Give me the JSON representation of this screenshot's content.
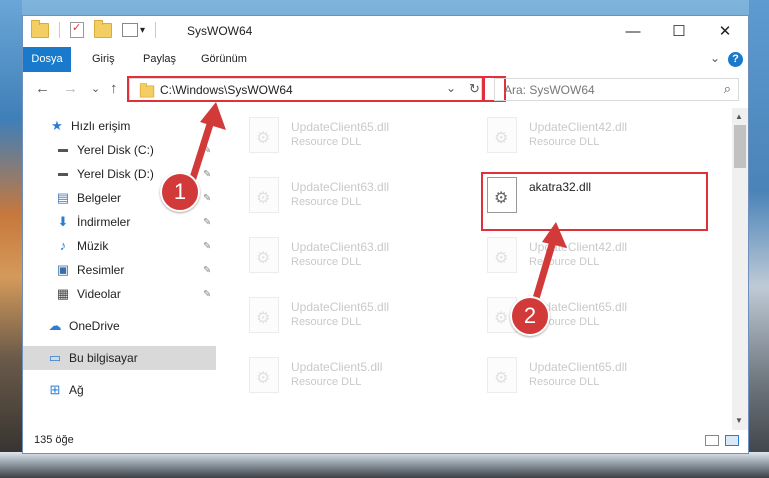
{
  "window": {
    "title": "SysWOW64"
  },
  "titlebar": {
    "minimize_glyph": "—",
    "maximize_glyph": "☐",
    "close_glyph": "✕",
    "qa_dropdown_glyph": "▾"
  },
  "menu": {
    "items": [
      "Dosya",
      "Giriş",
      "Paylaş",
      "Görünüm"
    ],
    "help_glyph": "?",
    "expand_glyph": "⌄"
  },
  "nav": {
    "back_glyph": "←",
    "forward_glyph": "→",
    "recent_glyph": "⌄",
    "up_glyph": "↑",
    "address": "C:\\Windows\\SysWOW64",
    "address_dropdown_glyph": "⌄",
    "refresh_glyph": "↻",
    "search_placeholder": "Ara: SysWOW64",
    "search_glyph": "⌕"
  },
  "sidebar": {
    "items": [
      {
        "label": "Hızlı erişim",
        "icon": "star-icon",
        "glyph": "★",
        "color": "#2b7cd3",
        "pinned": false
      },
      {
        "label": "Yerel Disk (C:)",
        "icon": "drive-icon",
        "glyph": "▬",
        "color": "#555555",
        "pinned": true
      },
      {
        "label": "Yerel Disk (D:)",
        "icon": "drive-icon",
        "glyph": "▬",
        "color": "#555555",
        "pinned": true
      },
      {
        "label": "Belgeler",
        "icon": "documents-icon",
        "glyph": "▤",
        "color": "#4a7ab5",
        "pinned": true
      },
      {
        "label": "İndirmeler",
        "icon": "download-icon",
        "glyph": "⬇",
        "color": "#2b7cd3",
        "pinned": true
      },
      {
        "label": "Müzik",
        "icon": "music-icon",
        "glyph": "♪",
        "color": "#2b7cd3",
        "pinned": true
      },
      {
        "label": "Resimler",
        "icon": "pictures-icon",
        "glyph": "▣",
        "color": "#3a6ea5",
        "pinned": true
      },
      {
        "label": "Videolar",
        "icon": "video-icon",
        "glyph": "▦",
        "color": "#444444",
        "pinned": true
      },
      {
        "label": "OneDrive",
        "icon": "cloud-icon",
        "glyph": "☁",
        "color": "#2b7cd3",
        "pinned": false
      },
      {
        "label": "Bu bilgisayar",
        "icon": "computer-icon",
        "glyph": "▭",
        "color": "#2b7cd3",
        "pinned": false
      },
      {
        "label": "Ağ",
        "icon": "network-icon",
        "glyph": "⊞",
        "color": "#2b7cd3",
        "pinned": false
      }
    ],
    "pin_glyph": "✎"
  },
  "files": [
    {
      "name": "UpdateClient65.dll",
      "type": "Resource DLL",
      "faded": true
    },
    {
      "name": "UpdateClient42.dll",
      "type": "Resource DLL",
      "faded": true
    },
    {
      "name": "UpdateClient63.dll",
      "type": "Resource DLL",
      "faded": true
    },
    {
      "name": "akatra32.dll",
      "type": "",
      "faded": false
    },
    {
      "name": "UpdateClient63.dll",
      "type": "Resource DLL",
      "faded": true
    },
    {
      "name": "UpdateClient42.dll",
      "type": "Resource DLL",
      "faded": true
    },
    {
      "name": "UpdateClient65.dll",
      "type": "Resource DLL",
      "faded": true
    },
    {
      "name": "UpdateClient65.dll",
      "type": "Resource DLL",
      "faded": true
    },
    {
      "name": "UpdateClient5.dll",
      "type": "Resource DLL",
      "faded": true
    },
    {
      "name": "UpdateClient65.dll",
      "type": "Resource DLL",
      "faded": true
    }
  ],
  "status": {
    "count": "135 öğe"
  },
  "annotations": {
    "step1": "1",
    "step2": "2",
    "highlight_color": "#e0313b"
  },
  "scrollbar": {
    "up_glyph": "▲",
    "down_glyph": "▼"
  }
}
